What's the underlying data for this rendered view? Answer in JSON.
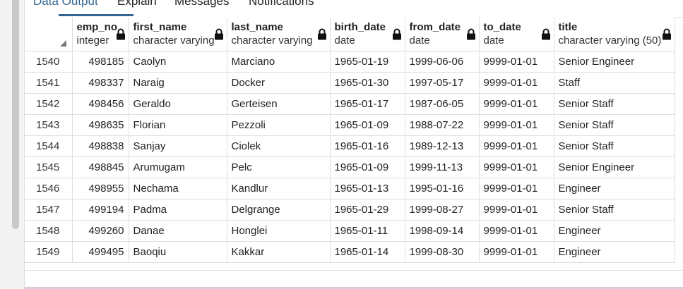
{
  "tabs": [
    {
      "label": "Data Output"
    },
    {
      "label": "Explain"
    },
    {
      "label": "Messages"
    },
    {
      "label": "Notifications"
    }
  ],
  "columns": [
    {
      "name": "emp_no",
      "type": "integer"
    },
    {
      "name": "first_name",
      "type": "character varying"
    },
    {
      "name": "last_name",
      "type": "character varying"
    },
    {
      "name": "birth_date",
      "type": "date"
    },
    {
      "name": "from_date",
      "type": "date"
    },
    {
      "name": "to_date",
      "type": "date"
    },
    {
      "name": "title",
      "type": "character varying (50)"
    }
  ],
  "rows": [
    {
      "n": "1540",
      "emp_no": "498185",
      "first_name": "Caolyn",
      "last_name": "Marciano",
      "birth_date": "1965-01-19",
      "from_date": "1999-06-06",
      "to_date": "9999-01-01",
      "title": "Senior Engineer"
    },
    {
      "n": "1541",
      "emp_no": "498337",
      "first_name": "Naraig",
      "last_name": "Docker",
      "birth_date": "1965-01-30",
      "from_date": "1997-05-17",
      "to_date": "9999-01-01",
      "title": "Staff"
    },
    {
      "n": "1542",
      "emp_no": "498456",
      "first_name": "Geraldo",
      "last_name": "Gerteisen",
      "birth_date": "1965-01-17",
      "from_date": "1987-06-05",
      "to_date": "9999-01-01",
      "title": "Senior Staff"
    },
    {
      "n": "1543",
      "emp_no": "498635",
      "first_name": "Florian",
      "last_name": "Pezzoli",
      "birth_date": "1965-01-09",
      "from_date": "1988-07-22",
      "to_date": "9999-01-01",
      "title": "Senior Staff"
    },
    {
      "n": "1544",
      "emp_no": "498838",
      "first_name": "Sanjay",
      "last_name": "Ciolek",
      "birth_date": "1965-01-16",
      "from_date": "1989-12-13",
      "to_date": "9999-01-01",
      "title": "Senior Staff"
    },
    {
      "n": "1545",
      "emp_no": "498845",
      "first_name": "Arumugam",
      "last_name": "Pelc",
      "birth_date": "1965-01-09",
      "from_date": "1999-11-13",
      "to_date": "9999-01-01",
      "title": "Senior Engineer"
    },
    {
      "n": "1546",
      "emp_no": "498955",
      "first_name": "Nechama",
      "last_name": "Kandlur",
      "birth_date": "1965-01-13",
      "from_date": "1995-01-16",
      "to_date": "9999-01-01",
      "title": "Engineer"
    },
    {
      "n": "1547",
      "emp_no": "499194",
      "first_name": "Padma",
      "last_name": "Delgrange",
      "birth_date": "1965-01-29",
      "from_date": "1999-08-27",
      "to_date": "9999-01-01",
      "title": "Senior Staff"
    },
    {
      "n": "1548",
      "emp_no": "499260",
      "first_name": "Danae",
      "last_name": "Honglei",
      "birth_date": "1965-01-11",
      "from_date": "1998-09-14",
      "to_date": "9999-01-01",
      "title": "Engineer"
    },
    {
      "n": "1549",
      "emp_no": "499495",
      "first_name": "Baoqiu",
      "last_name": "Kakkar",
      "birth_date": "1965-01-14",
      "from_date": "1999-08-30",
      "to_date": "9999-01-01",
      "title": "Engineer"
    }
  ],
  "colors": {
    "accent": "#326690",
    "grid_line": "#dedede"
  },
  "icons": {
    "column_lock": "lock-icon",
    "sort_corner": "sort-triangle-icon"
  }
}
